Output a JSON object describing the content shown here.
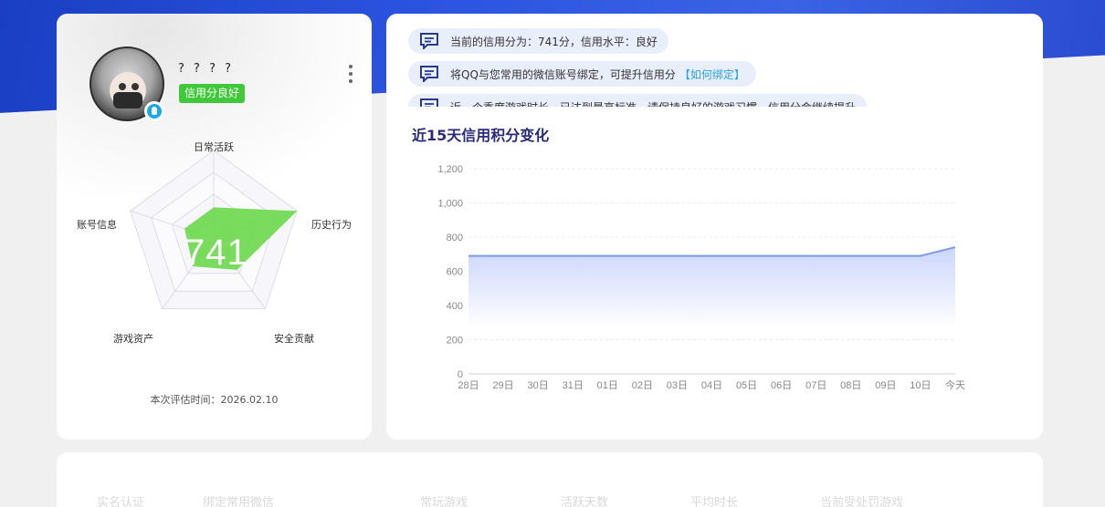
{
  "profile": {
    "nickname": "? ? ? ?",
    "credit_badge": "信用分良好",
    "score": "741",
    "eval_time": "本次评估时间：2026.02.10",
    "radar": {
      "labels": [
        "日常活跃",
        "历史行为",
        "安全贡献",
        "游戏资产",
        "账号信息"
      ],
      "values": [
        0.35,
        1.0,
        0.45,
        0.4,
        0.35
      ],
      "fill_color": "#6cd84a"
    }
  },
  "notices": [
    {
      "text": "当前的信用分为：741分，信用水平：良好",
      "link": ""
    },
    {
      "text": "将QQ与您常用的微信账号绑定，可提升信用分",
      "link": "【如何绑定】"
    },
    {
      "text": "近一个季度游戏时长，已达到最高标准，请保持良好的游戏习惯，信用分会继续提升",
      "link": ""
    }
  ],
  "chart_data": {
    "type": "area",
    "title": "近15天信用积分变化",
    "x": [
      "28日",
      "29日",
      "30日",
      "31日",
      "01日",
      "02日",
      "03日",
      "04日",
      "05日",
      "06日",
      "07日",
      "08日",
      "09日",
      "10日",
      "今天"
    ],
    "values": [
      690,
      690,
      690,
      690,
      690,
      690,
      690,
      690,
      690,
      690,
      690,
      690,
      690,
      690,
      741
    ],
    "yticks": [
      "0",
      "200",
      "400",
      "600",
      "800",
      "1,000",
      "1,200"
    ],
    "ylim": [
      0,
      1200
    ],
    "line_color": "#7a9af0",
    "grid": true
  },
  "bottom": {
    "items": [
      "实名认证",
      "绑定常用微信",
      "常玩游戏",
      "活跃天数",
      "平均时长",
      "当前受处罚游戏"
    ]
  },
  "colors": {
    "hero": "#2c55e0",
    "badge": "#3fc83a",
    "accent_link": "#2aa0e6"
  }
}
